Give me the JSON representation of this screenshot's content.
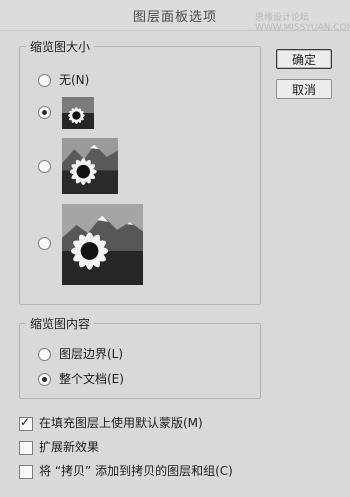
{
  "dialog": {
    "title": "图层面板选项",
    "watermark": "思缘设计论坛 WWW.MISSYUAN.COM"
  },
  "buttons": {
    "ok": "确定",
    "cancel": "取消"
  },
  "thumbnail_size": {
    "legend": "缩览图大小",
    "options": [
      {
        "label": "无(N)",
        "checked": false
      },
      {
        "label": "",
        "size": "small",
        "checked": true
      },
      {
        "label": "",
        "size": "medium",
        "checked": false
      },
      {
        "label": "",
        "size": "large",
        "checked": false
      }
    ]
  },
  "thumbnail_contents": {
    "legend": "缩览图内容",
    "options": [
      {
        "label": "图层边界(L)",
        "checked": false
      },
      {
        "label": "整个文档(E)",
        "checked": true
      }
    ]
  },
  "checkboxes": [
    {
      "label": "在填充图层上使用默认蒙版(M)",
      "checked": true
    },
    {
      "label": "扩展新效果",
      "checked": false
    },
    {
      "label": "将 “拷贝” 添加到拷贝的图层和组(C)",
      "checked": false
    }
  ],
  "thumbnail_image": "black-and-white sunflower with mountains"
}
